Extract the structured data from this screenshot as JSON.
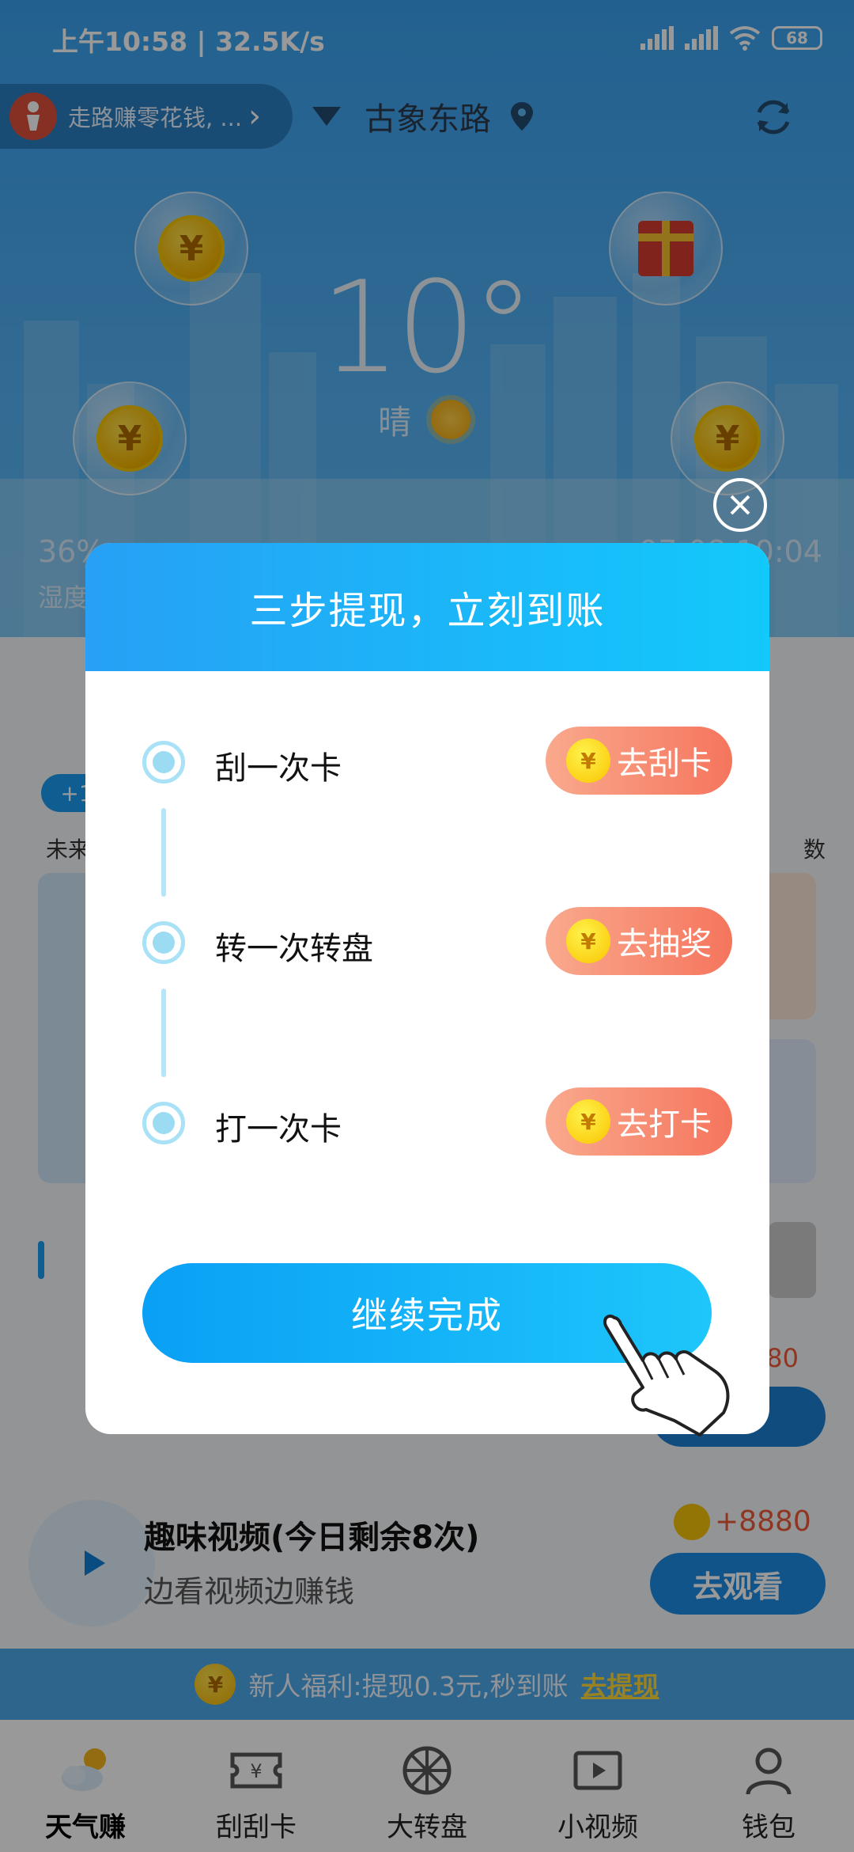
{
  "status_bar": {
    "time": "上午10:58 | 32.5K/s",
    "battery": "68"
  },
  "header": {
    "walk_text": "走路赚零花钱, ...",
    "location": "古象东路"
  },
  "weather": {
    "temperature": "10°",
    "condition": "晴",
    "humidity_value": "36%",
    "humidity_label": "湿度",
    "time_partial": "07-08 10:04"
  },
  "background": {
    "chip": "+1",
    "left_label": "未来",
    "right_label": "数",
    "video_title": "趣味视频(今日剩余8次)",
    "video_subtitle": "边看视频边赚钱",
    "video_amount": "+8880",
    "row_amount": "8880",
    "video_button": "去观看",
    "promo_text": "新人福利:提现0.3元,秒到账",
    "promo_link": "去提现",
    "coin_symbol": "¥"
  },
  "tabs": [
    {
      "label": "天气赚",
      "icon": "weather-icon",
      "active": true
    },
    {
      "label": "刮刮卡",
      "icon": "ticket-icon",
      "active": false
    },
    {
      "label": "大转盘",
      "icon": "wheel-icon",
      "active": false
    },
    {
      "label": "小视频",
      "icon": "video-icon",
      "active": false
    },
    {
      "label": "钱包",
      "icon": "profile-icon",
      "active": false
    }
  ],
  "dialog": {
    "title": "三步提现，立刻到账",
    "steps": [
      {
        "label": "刮一次卡",
        "button": "去刮卡"
      },
      {
        "label": "转一次转盘",
        "button": "去抽奖"
      },
      {
        "label": "打一次卡",
        "button": "去打卡"
      }
    ],
    "continue_button": "继续完成"
  },
  "colors": {
    "header_gradient_start": "#27a0f5",
    "header_gradient_end": "#12c9fb",
    "step_button": "#f5755d",
    "accent_blue": "#1a9bf2"
  }
}
